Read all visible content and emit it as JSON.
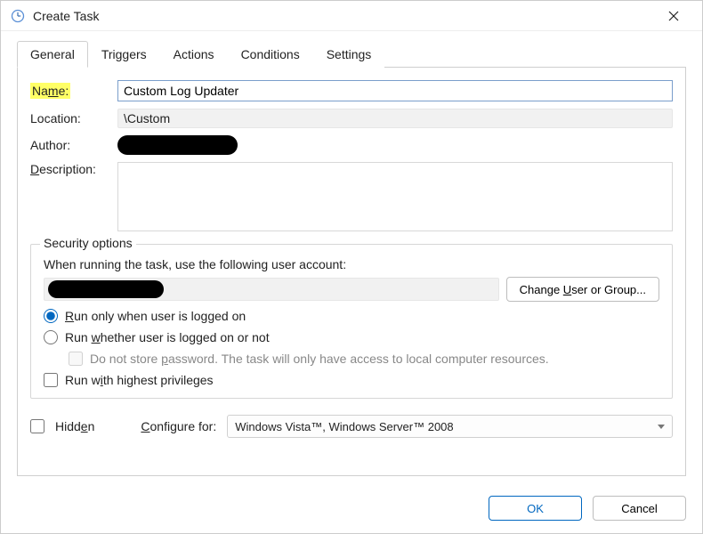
{
  "window": {
    "title": "Create Task"
  },
  "tabs": {
    "items": [
      {
        "label": "General",
        "active": true
      },
      {
        "label": "Triggers",
        "active": false
      },
      {
        "label": "Actions",
        "active": false
      },
      {
        "label": "Conditions",
        "active": false
      },
      {
        "label": "Settings",
        "active": false
      }
    ]
  },
  "general": {
    "name_label_pre": "Na",
    "name_label_u": "m",
    "name_label_post": "e:",
    "name_value": "Custom Log Updater",
    "location_label": "Location:",
    "location_value": "\\Custom",
    "author_label": "Author:",
    "description_label_u": "D",
    "description_label_rest": "escription:",
    "description_value": ""
  },
  "security": {
    "legend": "Security options",
    "running_label": "When running the task, use the following user account:",
    "change_user_pre": "Change ",
    "change_user_u": "U",
    "change_user_post": "ser or Group...",
    "run_logged_on_u": "R",
    "run_logged_on_rest": "un only when user is logged on",
    "run_whether_pre": "Run ",
    "run_whether_u": "w",
    "run_whether_post": "hether user is logged on or not",
    "no_store_pre": "Do not store ",
    "no_store_u": "p",
    "no_store_post": "assword.  The task will only have access to local computer resources.",
    "highest_pre": "Run w",
    "highest_u": "i",
    "highest_post": "th highest privileges"
  },
  "bottom": {
    "hidden_label_pre": "Hidd",
    "hidden_label_u": "e",
    "hidden_label_post": "n",
    "configure_label_u": "C",
    "configure_label_rest": "onfigure for:",
    "configure_value": "Windows Vista™, Windows Server™ 2008"
  },
  "footer": {
    "ok": "OK",
    "cancel": "Cancel"
  }
}
